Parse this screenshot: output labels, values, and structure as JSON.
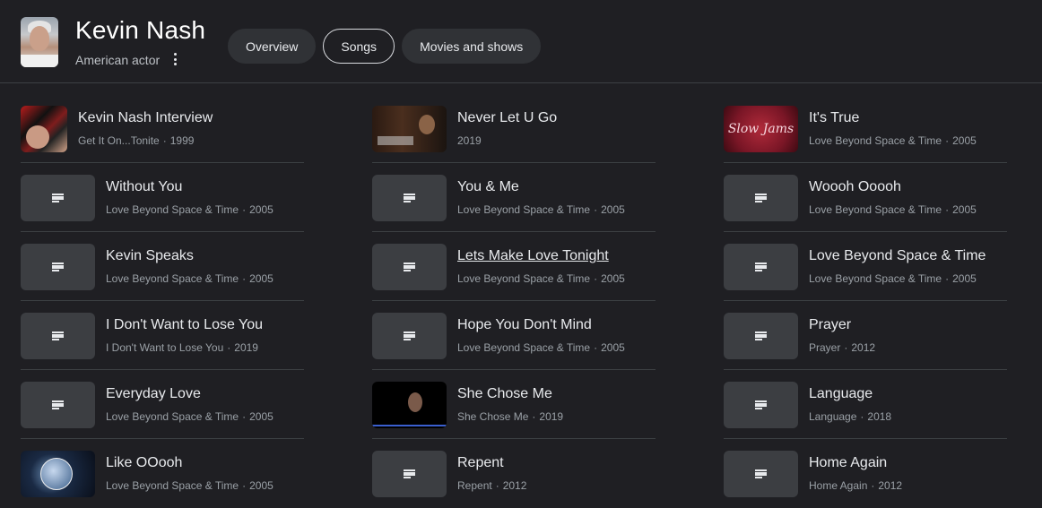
{
  "header": {
    "title": "Kevin Nash",
    "subtitle": "American actor",
    "tabs": [
      {
        "label": "Overview",
        "active": false
      },
      {
        "label": "Songs",
        "active": true
      },
      {
        "label": "Movies and shows",
        "active": false
      }
    ]
  },
  "columns": [
    [
      {
        "title": "Kevin Nash Interview",
        "album": "Get It On...Tonite",
        "year": "1999",
        "thumb": "image"
      },
      {
        "title": "Without You",
        "album": "Love Beyond Space & Time",
        "year": "2005",
        "thumb": "lyrics-icon"
      },
      {
        "title": "Kevin Speaks",
        "album": "Love Beyond Space & Time",
        "year": "2005",
        "thumb": "lyrics-icon"
      },
      {
        "title": "I Don't Want to Lose You",
        "album": "I Don't Want to Lose You",
        "year": "2019",
        "thumb": "lyrics-icon"
      },
      {
        "title": "Everyday Love",
        "album": "Love Beyond Space & Time",
        "year": "2005",
        "thumb": "lyrics-icon"
      },
      {
        "title": "Like OOooh",
        "album": "Love Beyond Space & Time",
        "year": "2005",
        "thumb": "image"
      }
    ],
    [
      {
        "title": "Never Let U Go",
        "album": "",
        "year": "2019",
        "thumb": "image"
      },
      {
        "title": "You & Me",
        "album": "Love Beyond Space & Time",
        "year": "2005",
        "thumb": "lyrics-icon"
      },
      {
        "title": "Lets Make Love Tonight",
        "album": "Love Beyond Space & Time",
        "year": "2005",
        "thumb": "lyrics-icon"
      },
      {
        "title": "Hope You Don't Mind",
        "album": "Love Beyond Space & Time",
        "year": "2005",
        "thumb": "lyrics-icon"
      },
      {
        "title": "She Chose Me",
        "album": "She Chose Me",
        "year": "2019",
        "thumb": "image"
      },
      {
        "title": "Repent",
        "album": "Repent",
        "year": "2012",
        "thumb": "lyrics-icon"
      }
    ],
    [
      {
        "title": "It's True",
        "album": "Love Beyond Space & Time",
        "year": "2005",
        "thumb": "image",
        "thumb_text": "Slow Jams"
      },
      {
        "title": "Woooh Ooooh",
        "album": "Love Beyond Space & Time",
        "year": "2005",
        "thumb": "lyrics-icon"
      },
      {
        "title": "Love Beyond Space & Time",
        "album": "Love Beyond Space & Time",
        "year": "2005",
        "thumb": "lyrics-icon"
      },
      {
        "title": "Prayer",
        "album": "Prayer",
        "year": "2012",
        "thumb": "lyrics-icon"
      },
      {
        "title": "Language",
        "album": "Language",
        "year": "2018",
        "thumb": "lyrics-icon"
      },
      {
        "title": "Home Again",
        "album": "Home Again",
        "year": "2012",
        "thumb": "lyrics-icon"
      }
    ]
  ],
  "colors": {
    "background": "#1f1f23",
    "chip": "#303236",
    "thumb": "#3c3e42",
    "separator": "#3c4043"
  }
}
